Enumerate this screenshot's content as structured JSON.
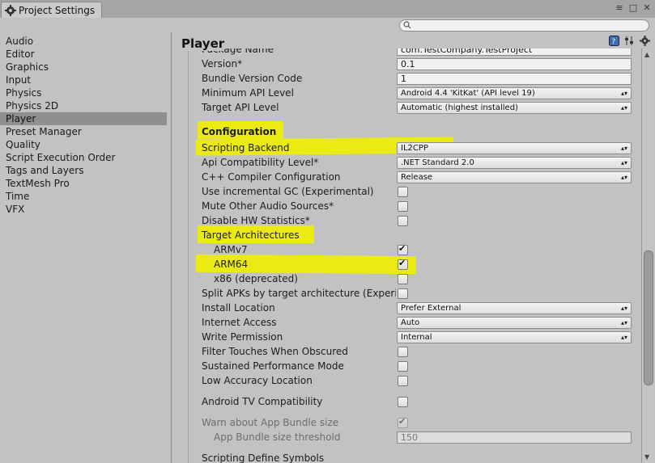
{
  "window": {
    "tab_title": "Project Settings",
    "controls": [
      "≡",
      "□",
      "✕"
    ]
  },
  "search": {
    "placeholder": ""
  },
  "sidebar": {
    "items": [
      {
        "label": "Audio"
      },
      {
        "label": "Editor"
      },
      {
        "label": "Graphics"
      },
      {
        "label": "Input"
      },
      {
        "label": "Physics"
      },
      {
        "label": "Physics 2D"
      },
      {
        "label": "Player",
        "selected": true
      },
      {
        "label": "Preset Manager"
      },
      {
        "label": "Quality"
      },
      {
        "label": "Script Execution Order"
      },
      {
        "label": "Tags and Layers"
      },
      {
        "label": "TextMesh Pro"
      },
      {
        "label": "Time"
      },
      {
        "label": "VFX"
      }
    ]
  },
  "main": {
    "title": "Player",
    "package_name": {
      "label": "Package Name",
      "value": "com.TestCompany.TestProject"
    },
    "version": {
      "label": "Version*",
      "value": "0.1"
    },
    "bundle_version_code": {
      "label": "Bundle Version Code",
      "value": "1"
    },
    "min_api": {
      "label": "Minimum API Level",
      "value": "Android 4.4 'KitKat' (API level 19)"
    },
    "target_api": {
      "label": "Target API Level",
      "value": "Automatic (highest installed)"
    },
    "configuration": "Configuration",
    "scripting_backend": {
      "label": "Scripting Backend",
      "value": "IL2CPP"
    },
    "api_compat": {
      "label": "Api Compatibility Level*",
      "value": ".NET Standard 2.0"
    },
    "cpp_config": {
      "label": "C++ Compiler Configuration",
      "value": "Release"
    },
    "incremental_gc": {
      "label": "Use incremental GC (Experimental)",
      "checked": false
    },
    "mute_audio": {
      "label": "Mute Other Audio Sources*",
      "checked": false
    },
    "disable_hw": {
      "label": "Disable HW Statistics*",
      "checked": false
    },
    "target_arch": "Target Architectures",
    "armv7": {
      "label": "ARMv7",
      "checked": true
    },
    "arm64": {
      "label": "ARM64",
      "checked": true
    },
    "x86": {
      "label": "x86 (deprecated)",
      "checked": false
    },
    "split_apks": {
      "label": "Split APKs by target architecture (Experim",
      "checked": false
    },
    "install_location": {
      "label": "Install Location",
      "value": "Prefer External"
    },
    "internet_access": {
      "label": "Internet Access",
      "value": "Auto"
    },
    "write_permission": {
      "label": "Write Permission",
      "value": "Internal"
    },
    "filter_touches": {
      "label": "Filter Touches When Obscured",
      "checked": false
    },
    "sustained_perf": {
      "label": "Sustained Performance Mode",
      "checked": false
    },
    "low_accuracy": {
      "label": "Low Accuracy Location",
      "checked": false
    },
    "android_tv": {
      "label": "Android TV Compatibility",
      "checked": false
    },
    "warn_bundle": {
      "label": "Warn about App Bundle size",
      "checked": true
    },
    "bundle_threshold": {
      "label": "App Bundle size threshold",
      "value": "150"
    },
    "define_symbols": {
      "label": "Scripting Define Symbols"
    }
  },
  "colors": {
    "highlight": "#f0f000",
    "selected_item": "#8f8f8f",
    "background": "#c2c2c2"
  }
}
